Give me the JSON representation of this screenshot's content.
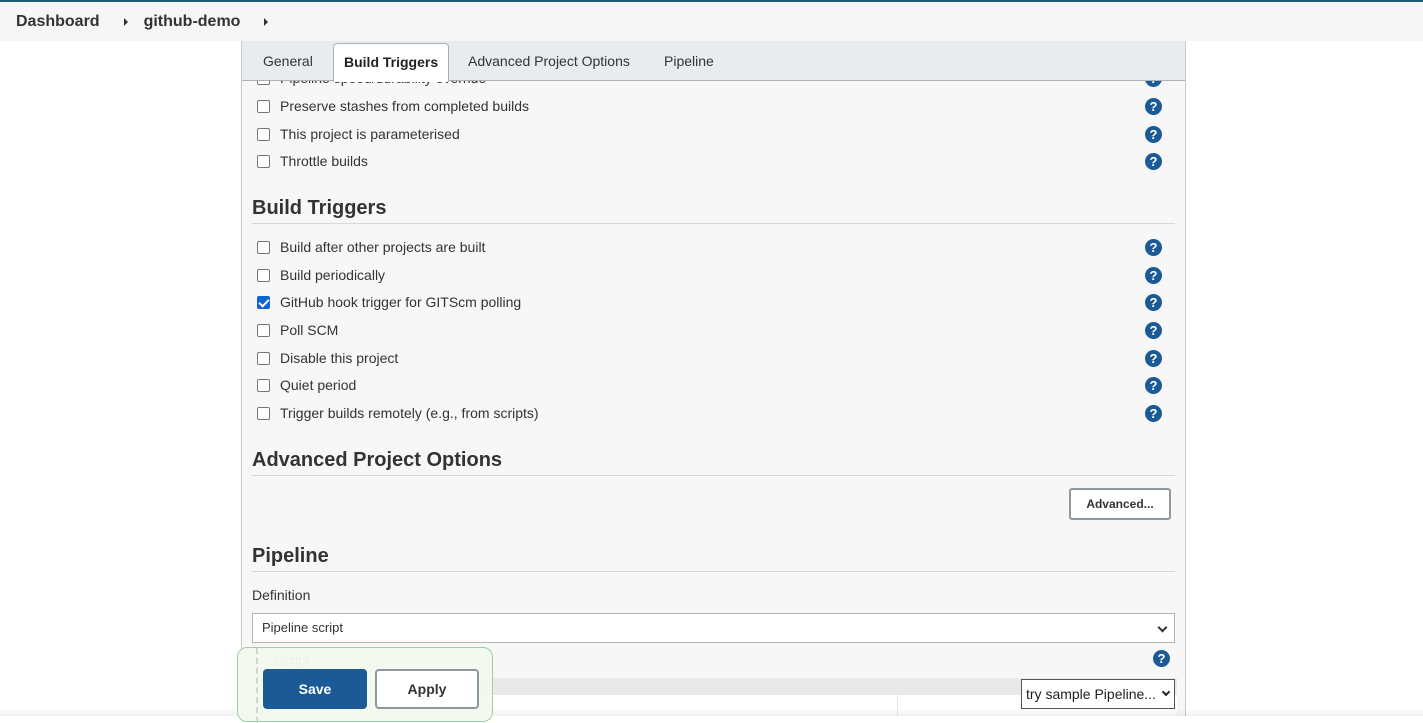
{
  "breadcrumb": {
    "items": [
      "Dashboard",
      "github-demo"
    ]
  },
  "tabs": [
    {
      "label": "General",
      "active": false
    },
    {
      "label": "Build Triggers",
      "active": true
    },
    {
      "label": "Advanced Project Options",
      "active": false
    },
    {
      "label": "Pipeline",
      "active": false
    }
  ],
  "general_options": [
    {
      "label": "Pipeline speed/durability override",
      "checked": false
    },
    {
      "label": "Preserve stashes from completed builds",
      "checked": false
    },
    {
      "label": "This project is parameterised",
      "checked": false
    },
    {
      "label": "Throttle builds",
      "checked": false
    }
  ],
  "build_triggers": {
    "title": "Build Triggers",
    "options": [
      {
        "label": "Build after other projects are built",
        "checked": false
      },
      {
        "label": "Build periodically",
        "checked": false
      },
      {
        "label": "GitHub hook trigger for GITScm polling",
        "checked": true
      },
      {
        "label": "Poll SCM",
        "checked": false
      },
      {
        "label": "Disable this project",
        "checked": false
      },
      {
        "label": "Quiet period",
        "checked": false
      },
      {
        "label": "Trigger builds remotely (e.g., from scripts)",
        "checked": false
      }
    ]
  },
  "advanced_options": {
    "title": "Advanced Project Options",
    "button_label": "Advanced..."
  },
  "pipeline": {
    "title": "Pipeline",
    "definition_label": "Definition",
    "definition_value": "Pipeline script",
    "script_label": "Script",
    "sample_select_value": "try sample Pipeline..."
  },
  "actions": {
    "save_label": "Save",
    "apply_label": "Apply"
  },
  "help_icon_glyph": "?",
  "colors": {
    "primary": "#1b5a94",
    "checkbox_checked": "#0e63d6"
  }
}
